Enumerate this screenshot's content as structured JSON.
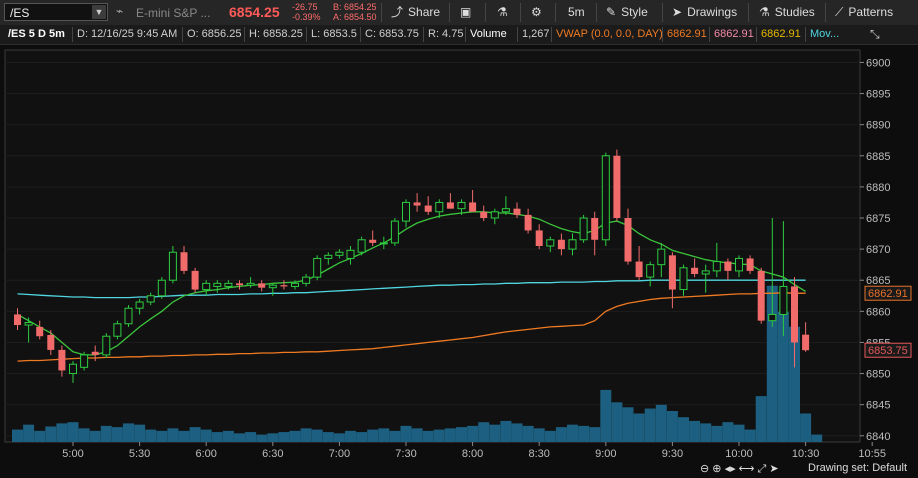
{
  "toolbar": {
    "symbol": "/ES",
    "symbol_dropdown_icon": "chevron-down-icon",
    "description": "E-mini S&P ...",
    "last_price": "6854.25",
    "change": "-26.75",
    "change_pct": "-0.39%",
    "bid": "B: 6854.25",
    "ask": "A: 6854.50",
    "share_label": "Share",
    "timeframe_label": "5m",
    "style_label": "Style",
    "drawings_label": "Drawings",
    "studies_label": "Studies",
    "patterns_label": "Patterns"
  },
  "header": {
    "title": "/ES 5 D 5m",
    "date": "D: 12/16/25 9:45 AM",
    "open": "O: 6856.25",
    "high": "H: 6858.25",
    "low": "L: 6853.5",
    "close": "C: 6853.75",
    "range": "R: 4.75",
    "volume_label": "Volume",
    "volume_value": "1,267",
    "vwap_label": "VWAP (0.0, 0.0, DAY)",
    "vwap_value": "6862.91",
    "value2": "6862.91",
    "value3": "6862.91",
    "mov_label": "Mov..."
  },
  "colors": {
    "up": "#2ecc40",
    "down": "#f26b6b",
    "vwap": "#f07a22",
    "cyan_ma": "#4fd6e0",
    "green_ma": "#3bc43b",
    "volume": "#1c5f80",
    "price_red_tag": "#e65858",
    "price_orange_tag": "#e8712a"
  },
  "chart_data": {
    "type": "candlestick",
    "ylim": [
      6839,
      6902
    ],
    "y_ticks": [
      6900,
      6895,
      6890,
      6885,
      6880,
      6875,
      6870,
      6865,
      6860,
      6855,
      6850,
      6845,
      6840
    ],
    "x_ticks": [
      "5:00",
      "5:30",
      "6:00",
      "6:30",
      "7:00",
      "7:30",
      "8:00",
      "8:30",
      "9:00",
      "9:30",
      "10:00",
      "10:30",
      "10:55"
    ],
    "x_start": "4:35",
    "interval_minutes": 5,
    "price_tags": [
      "6862.91",
      "6853.75"
    ],
    "candles": [
      [
        6859.5,
        6860.5,
        6857.0,
        6857.8
      ],
      [
        6857.8,
        6859.0,
        6855.0,
        6858.2
      ],
      [
        6857.5,
        6858.5,
        6855.5,
        6856.0
      ],
      [
        6856.2,
        6857.0,
        6853.0,
        6853.8
      ],
      [
        6853.8,
        6854.5,
        6849.5,
        6850.5
      ],
      [
        6850.0,
        6852.0,
        6848.5,
        6851.5
      ],
      [
        6851.0,
        6853.5,
        6850.5,
        6853.0
      ],
      [
        6853.5,
        6854.5,
        6852.0,
        6853.0
      ],
      [
        6853.0,
        6856.5,
        6852.5,
        6856.0
      ],
      [
        6856.0,
        6858.5,
        6855.5,
        6858.0
      ],
      [
        6858.0,
        6861.0,
        6857.5,
        6860.5
      ],
      [
        6860.5,
        6862.0,
        6859.5,
        6861.5
      ],
      [
        6861.5,
        6863.0,
        6861.0,
        6862.5
      ],
      [
        6862.5,
        6865.5,
        6862.0,
        6865.0
      ],
      [
        6865.0,
        6870.5,
        6864.5,
        6869.5
      ],
      [
        6869.5,
        6870.5,
        6866.0,
        6866.5
      ],
      [
        6866.5,
        6867.0,
        6863.0,
        6863.5
      ],
      [
        6863.5,
        6865.0,
        6862.5,
        6864.5
      ],
      [
        6864.0,
        6865.0,
        6863.0,
        6864.5
      ],
      [
        6864.0,
        6865.0,
        6863.5,
        6864.5
      ],
      [
        6864.5,
        6865.0,
        6863.5,
        6864.2
      ],
      [
        6864.2,
        6865.5,
        6863.8,
        6864.5
      ],
      [
        6864.5,
        6865.0,
        6863.2,
        6863.8
      ],
      [
        6863.8,
        6864.5,
        6862.5,
        6864.2
      ],
      [
        6864.2,
        6865.0,
        6863.5,
        6864.0
      ],
      [
        6864.0,
        6865.0,
        6863.5,
        6864.5
      ],
      [
        6864.5,
        6866.0,
        6864.0,
        6865.5
      ],
      [
        6865.5,
        6869.0,
        6865.0,
        6868.5
      ],
      [
        6868.5,
        6869.5,
        6867.5,
        6869.0
      ],
      [
        6869.0,
        6870.0,
        6868.5,
        6869.5
      ],
      [
        6868.5,
        6870.5,
        6867.5,
        6869.8
      ],
      [
        6869.5,
        6872.0,
        6869.0,
        6871.5
      ],
      [
        6871.5,
        6873.0,
        6870.5,
        6871.0
      ],
      [
        6871.0,
        6872.0,
        6870.0,
        6871.0
      ],
      [
        6871.0,
        6875.0,
        6870.5,
        6874.5
      ],
      [
        6874.5,
        6878.0,
        6873.5,
        6877.5
      ],
      [
        6877.5,
        6879.0,
        6876.0,
        6877.0
      ],
      [
        6877.0,
        6878.5,
        6875.5,
        6876.0
      ],
      [
        6876.0,
        6878.0,
        6875.0,
        6877.5
      ],
      [
        6877.5,
        6879.0,
        6876.5,
        6876.5
      ],
      [
        6876.5,
        6878.0,
        6875.5,
        6877.5
      ],
      [
        6877.5,
        6879.5,
        6876.0,
        6876.0
      ],
      [
        6876.0,
        6877.0,
        6874.5,
        6875.0
      ],
      [
        6875.0,
        6876.5,
        6874.0,
        6876.0
      ],
      [
        6876.0,
        6878.5,
        6875.5,
        6876.5
      ],
      [
        6876.5,
        6877.5,
        6875.0,
        6875.5
      ],
      [
        6875.5,
        6876.5,
        6872.5,
        6873.0
      ],
      [
        6873.0,
        6874.0,
        6870.0,
        6870.5
      ],
      [
        6870.5,
        6872.0,
        6869.5,
        6871.5
      ],
      [
        6871.5,
        6872.5,
        6869.0,
        6870.0
      ],
      [
        6870.0,
        6872.5,
        6869.0,
        6871.5
      ],
      [
        6871.5,
        6875.5,
        6871.0,
        6875.0
      ],
      [
        6875.0,
        6876.0,
        6869.0,
        6871.5
      ],
      [
        6871.5,
        6885.5,
        6870.5,
        6885.0
      ],
      [
        6885.0,
        6886.0,
        6874.5,
        6875.0
      ],
      [
        6875.0,
        6876.5,
        6867.5,
        6868.0
      ],
      [
        6868.0,
        6870.5,
        6865.0,
        6865.5
      ],
      [
        6865.5,
        6868.0,
        6864.0,
        6867.5
      ],
      [
        6867.5,
        6871.0,
        6865.5,
        6870.0
      ],
      [
        6869.0,
        6869.5,
        6860.5,
        6863.5
      ],
      [
        6863.5,
        6867.5,
        6862.5,
        6867.0
      ],
      [
        6867.0,
        6868.5,
        6865.5,
        6866.0
      ],
      [
        6866.0,
        6867.5,
        6863.0,
        6866.5
      ],
      [
        6866.5,
        6871.0,
        6865.5,
        6868.0
      ],
      [
        6868.0,
        6868.5,
        6865.0,
        6866.5
      ],
      [
        6866.5,
        6869.0,
        6865.5,
        6868.5
      ],
      [
        6868.5,
        6869.0,
        6866.0,
        6866.5
      ],
      [
        6866.5,
        6867.0,
        6858.0,
        6858.5
      ],
      [
        6858.5,
        6875.0,
        6857.5,
        6859.5
      ],
      [
        6859.5,
        6874.5,
        6856.0,
        6864.0
      ],
      [
        6864.0,
        6865.5,
        6851.0,
        6855.0
      ],
      [
        6856.25,
        6858.25,
        6853.5,
        6853.75
      ]
    ],
    "volume": [
      20,
      28,
      18,
      25,
      30,
      32,
      22,
      18,
      26,
      24,
      30,
      28,
      20,
      18,
      22,
      18,
      24,
      20,
      16,
      18,
      14,
      16,
      12,
      14,
      16,
      18,
      22,
      20,
      16,
      14,
      18,
      16,
      20,
      22,
      18,
      26,
      22,
      18,
      20,
      22,
      24,
      26,
      32,
      28,
      34,
      30,
      26,
      22,
      18,
      24,
      28,
      26,
      24,
      84,
      64,
      56,
      46,
      54,
      60,
      50,
      40,
      34,
      30,
      26,
      32,
      28,
      20,
      74,
      252,
      210,
      186,
      46,
      12
    ],
    "vwap": [
      6852.0,
      6852.1,
      6852.1,
      6852.2,
      6852.3,
      6852.4,
      6852.5,
      6852.5,
      6852.6,
      6852.6,
      6852.7,
      6852.7,
      6852.8,
      6852.8,
      6852.9,
      6852.9,
      6853.0,
      6853.0,
      6853.1,
      6853.1,
      6853.2,
      6853.2,
      6853.3,
      6853.3,
      6853.4,
      6853.4,
      6853.5,
      6853.5,
      6853.6,
      6853.7,
      6853.8,
      6853.9,
      6854.0,
      6854.2,
      6854.4,
      6854.6,
      6854.8,
      6855.0,
      6855.2,
      6855.4,
      6855.6,
      6855.8,
      6856.1,
      6856.4,
      6856.7,
      6856.9,
      6857.1,
      6857.3,
      6857.5,
      6857.6,
      6857.7,
      6857.8,
      6858.5,
      6860.0,
      6860.8,
      6861.3,
      6861.6,
      6861.9,
      6862.1,
      6862.2,
      6862.3,
      6862.4,
      6862.5,
      6862.6,
      6862.7,
      6862.8,
      6862.8,
      6862.9,
      6862.9,
      6863.0,
      6862.9,
      6862.91
    ],
    "cyan_ma": [
      6862.8,
      6862.7,
      6862.6,
      6862.5,
      6862.4,
      6862.3,
      6862.3,
      6862.2,
      6862.2,
      6862.2,
      6862.2,
      6862.3,
      6862.3,
      6862.4,
      6862.5,
      6862.6,
      6862.6,
      6862.6,
      6862.7,
      6862.7,
      6862.7,
      6862.8,
      6862.8,
      6862.9,
      6862.9,
      6863.0,
      6863.0,
      6863.1,
      6863.2,
      6863.3,
      6863.4,
      6863.5,
      6863.6,
      6863.7,
      6863.8,
      6863.9,
      6864.0,
      6864.1,
      6864.2,
      6864.2,
      6864.3,
      6864.3,
      6864.4,
      6864.4,
      6864.5,
      6864.5,
      6864.6,
      6864.6,
      6864.6,
      6864.7,
      6864.7,
      6864.7,
      6864.8,
      6864.8,
      6864.9,
      6864.9,
      6864.9,
      6865.0,
      6865.0,
      6865.0,
      6865.0,
      6865.0,
      6865.0,
      6865.0,
      6865.0,
      6865.0,
      6865.0,
      6865.0,
      6865.0,
      6865.0,
      6865.0,
      6865.0
    ],
    "green_ma": [
      6859.5,
      6858.5,
      6857.5,
      6856.5,
      6855.0,
      6853.5,
      6853.0,
      6853.0,
      6853.5,
      6854.5,
      6856.0,
      6857.5,
      6858.8,
      6860.0,
      6861.5,
      6862.5,
      6863.0,
      6863.3,
      6863.5,
      6863.8,
      6864.0,
      6864.2,
      6864.3,
      6864.5,
      6864.6,
      6864.7,
      6865.0,
      6865.8,
      6866.8,
      6867.8,
      6868.5,
      6869.3,
      6870.2,
      6871.0,
      6872.0,
      6873.2,
      6874.2,
      6874.8,
      6875.3,
      6875.6,
      6875.8,
      6876.0,
      6876.0,
      6875.8,
      6875.8,
      6875.6,
      6875.3,
      6874.8,
      6874.0,
      6873.3,
      6872.8,
      6872.5,
      6873.0,
      6874.2,
      6874.5,
      6873.8,
      6872.5,
      6871.5,
      6870.8,
      6869.8,
      6869.3,
      6868.8,
      6868.3,
      6868.0,
      6867.8,
      6867.6,
      6867.5,
      6866.5,
      6866.0,
      6865.5,
      6864.3,
      6863.2
    ]
  },
  "footer": {
    "drawing_set": "Drawing set: Default"
  }
}
